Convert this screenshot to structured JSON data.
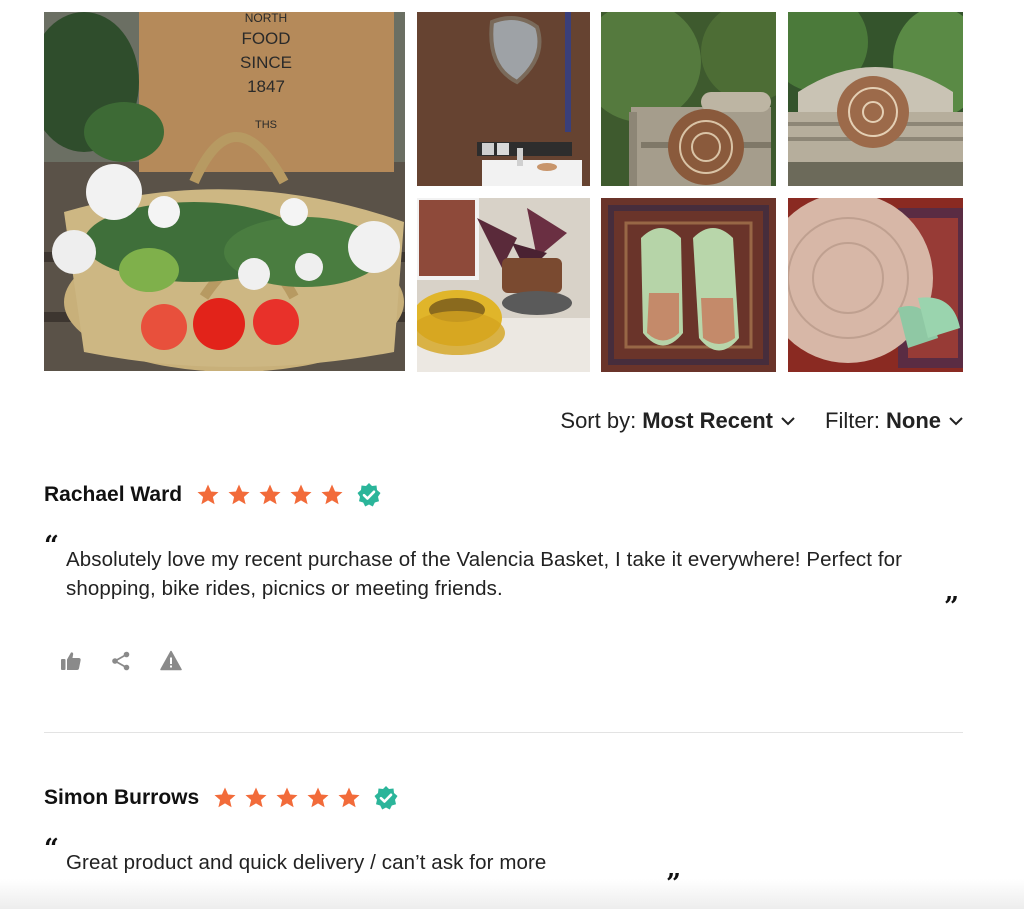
{
  "gallery": {
    "images": [
      {
        "name": "basket-with-flowers",
        "sign_lines": [
          "NORTH",
          "FOOD",
          "SINCE",
          "1847",
          "—",
          "THS"
        ]
      },
      {
        "name": "sink-with-mirror"
      },
      {
        "name": "pouf-on-bench-garden"
      },
      {
        "name": "pouf-on-bench-front"
      },
      {
        "name": "plant-and-raffia-basket"
      },
      {
        "name": "green-slippers"
      },
      {
        "name": "pouf-on-rug"
      }
    ]
  },
  "controls": {
    "sort_label": "Sort by:",
    "sort_value": "Most Recent",
    "filter_label": "Filter:",
    "filter_value": "None"
  },
  "colors": {
    "star": "#f26b3a",
    "verified": "#2bb59a",
    "icon_gray": "#8a8a8a"
  },
  "reviews": [
    {
      "author": "Rachael Ward",
      "rating": 5,
      "verified": true,
      "text": "Absolutely love my recent purchase of the Valencia Basket, I take it everywhere! Perfect for shopping, bike rides, picnics or meeting friends.",
      "actions": [
        "thumbs-up-icon",
        "share-icon",
        "report-warning-icon"
      ]
    },
    {
      "author": "Simon Burrows",
      "rating": 5,
      "verified": true,
      "text": "Great product and quick delivery / can’t ask for more"
    }
  ]
}
